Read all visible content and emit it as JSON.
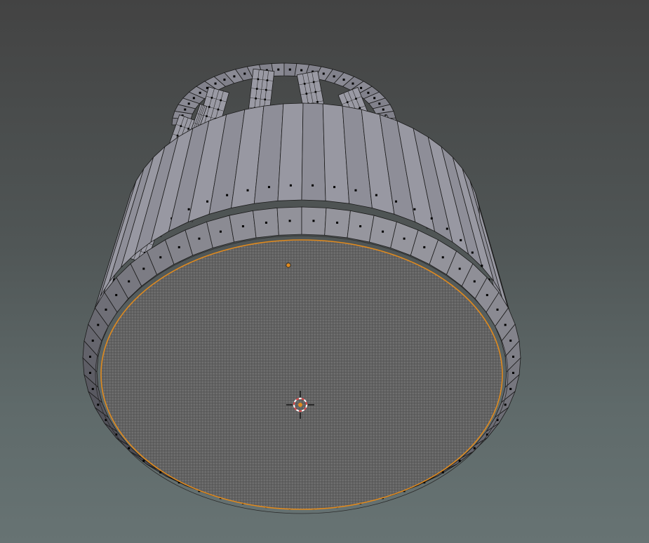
{
  "viewport": {
    "mode": "edit-mode",
    "view": "3d-perspective",
    "background_top": "#434343",
    "background_bottom": "#677373"
  },
  "mesh": {
    "object_type": "cage-cylinder",
    "bar_count_visible": 7,
    "mesh_color": "#8c8c96",
    "wire_color": "#1a1a1a",
    "vertex_color": "#000000",
    "selected_face": "bottom-cap",
    "selection_color": "#e08a1e",
    "face_fill": "#6a6a6a"
  },
  "cursor": {
    "icon": "3d-cursor-icon",
    "ring_color_1": "#e04a4a",
    "ring_color_2": "#ffffff"
  },
  "origin": {
    "icon": "object-origin-icon",
    "color": "#e08a1e"
  }
}
